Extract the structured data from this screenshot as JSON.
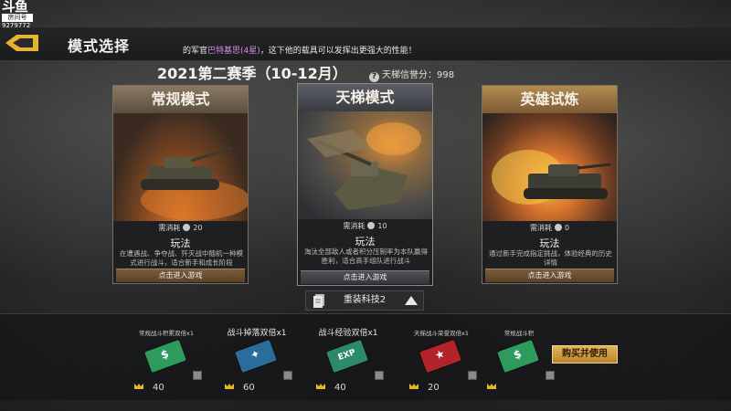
{
  "watermark": {
    "logo": "斗鱼",
    "badge": "房间号",
    "room_id": "9279772"
  },
  "header": {
    "title": "模式选择",
    "back_icon": "back-arrow-icon"
  },
  "notice": {
    "prefix": "的军官",
    "highlight": "巴特基思(4星)",
    "suffix": "，这下他的载具可以发挥出更强大的性能！"
  },
  "season": {
    "title": "2021第二赛季（10-12月）",
    "ladder_score_label": "天梯信誉分：998"
  },
  "modes": [
    {
      "name": "常规模式",
      "cost_label": "需消耗",
      "cost": "20",
      "play_label": "玩法",
      "desc": "在遭遇战、争夺战、歼灭战中随机一种模式进行战斗，适合新手和成长阶段",
      "enter": "点击进入游戏"
    },
    {
      "name": "天梯模式",
      "cost_label": "需消耗",
      "cost": "10",
      "play_label": "玩法",
      "desc": "淘汰全部敌人或者积分压制率为本队赢得胜利，适合高手组队进行战斗",
      "enter": "点击进入游戏"
    },
    {
      "name": "英雄试炼",
      "cost_label": "需消耗",
      "cost": "0",
      "play_label": "玩法",
      "desc": "通过新手完成指定挑战，体验经典的历史详情",
      "enter": "点击进入游戏"
    }
  ],
  "tech_selector": {
    "label": "重装科技2"
  },
  "items": [
    {
      "name": "常规战斗积累双倍x1",
      "glyph": "$",
      "color": "#2e9a5c",
      "price": "40",
      "small": true
    },
    {
      "name": "战斗掉落双倍x1",
      "glyph": "✦",
      "color": "#2a6d9a",
      "price": "60",
      "small": false
    },
    {
      "name": "战斗经验双倍x1",
      "glyph": "EXP",
      "color": "#2b8a6b",
      "price": "40",
      "small": false
    },
    {
      "name": "天梯战斗荣誉双倍x1",
      "glyph": "★",
      "color": "#b3242a",
      "price": "20",
      "small": true
    },
    {
      "name": "常规战斗积",
      "glyph": "$",
      "color": "#2e9a5c",
      "price": "",
      "small": true
    }
  ],
  "buy_button": "购买并使用"
}
